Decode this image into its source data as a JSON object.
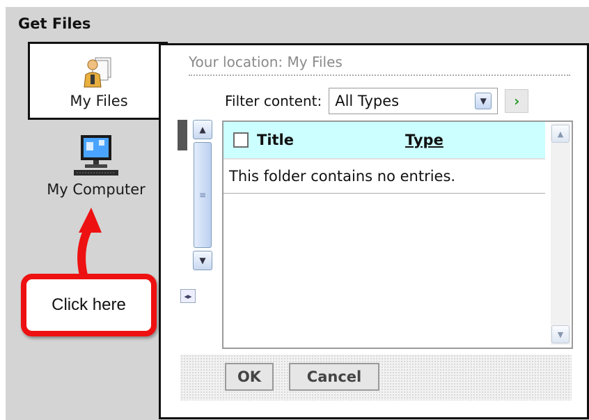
{
  "dialog": {
    "title": "Get Files"
  },
  "sidebar": {
    "items": [
      {
        "label": "My Files",
        "icon": "user-files-icon",
        "active": true
      },
      {
        "label": "My Computer",
        "icon": "computer-icon",
        "active": false
      }
    ]
  },
  "main": {
    "location": "Your location: My Files",
    "filter": {
      "label": "Filter content:",
      "value": "All Types"
    },
    "table": {
      "columns": [
        "Title",
        "Type"
      ],
      "empty_message": "This folder contains no entries."
    },
    "buttons": {
      "ok": "OK",
      "cancel": "Cancel"
    }
  },
  "annotation": {
    "text": "Click here",
    "color": "#ee1111"
  }
}
